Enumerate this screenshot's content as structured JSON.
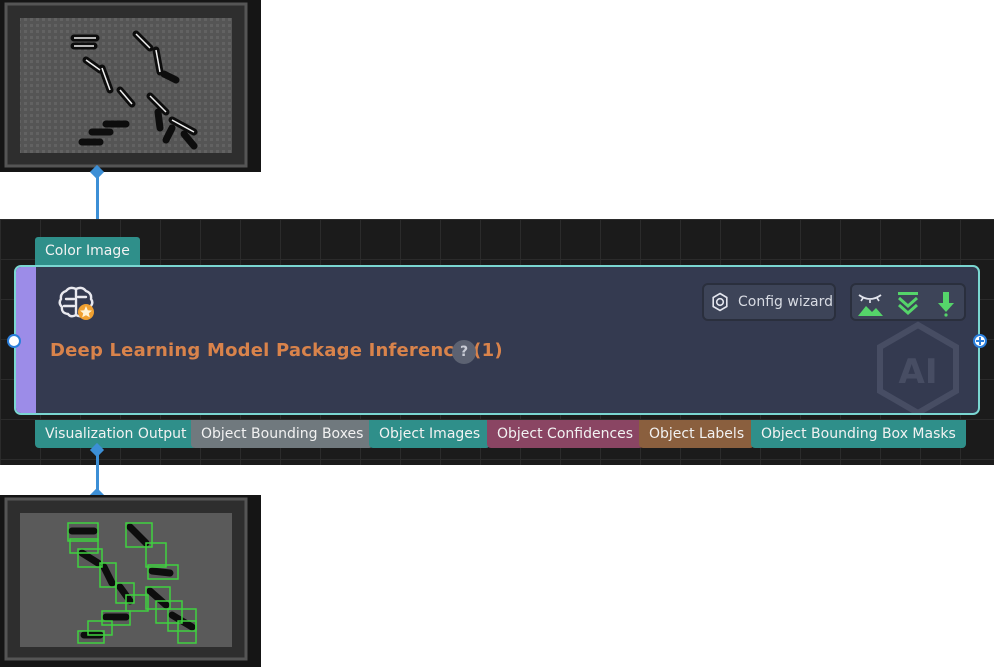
{
  "node": {
    "title": "Deep Learning Model Package Inference (1)",
    "help_label": "?",
    "config_wizard_label": "Config wizard",
    "icon": "brain-chip-icon",
    "toolbar_icons": [
      "visualization-eye-icon",
      "collapse-chevrons-icon",
      "download-arrow-icon"
    ],
    "watermark": "AI"
  },
  "input_ports": [
    {
      "label": "Color Image",
      "color": "#2f8f8a"
    }
  ],
  "output_ports": [
    {
      "label": "Visualization Output",
      "color": "#2f8f8a"
    },
    {
      "label": "Object Bounding Boxes",
      "color": "#70797e"
    },
    {
      "label": "Object Images",
      "color": "#2f8f8a"
    },
    {
      "label": "Object Confidences",
      "color": "#8a4563"
    },
    {
      "label": "Object Labels",
      "color": "#8a5f3e"
    },
    {
      "label": "Object Bounding Box Masks",
      "color": "#2f8f8a"
    }
  ],
  "colors": {
    "node_border": "#7ad6d1",
    "node_stripe": "#9c8ce8",
    "title": "#d9834b",
    "connector": "#3c8fd6",
    "detection_box": "#3fd23f"
  }
}
